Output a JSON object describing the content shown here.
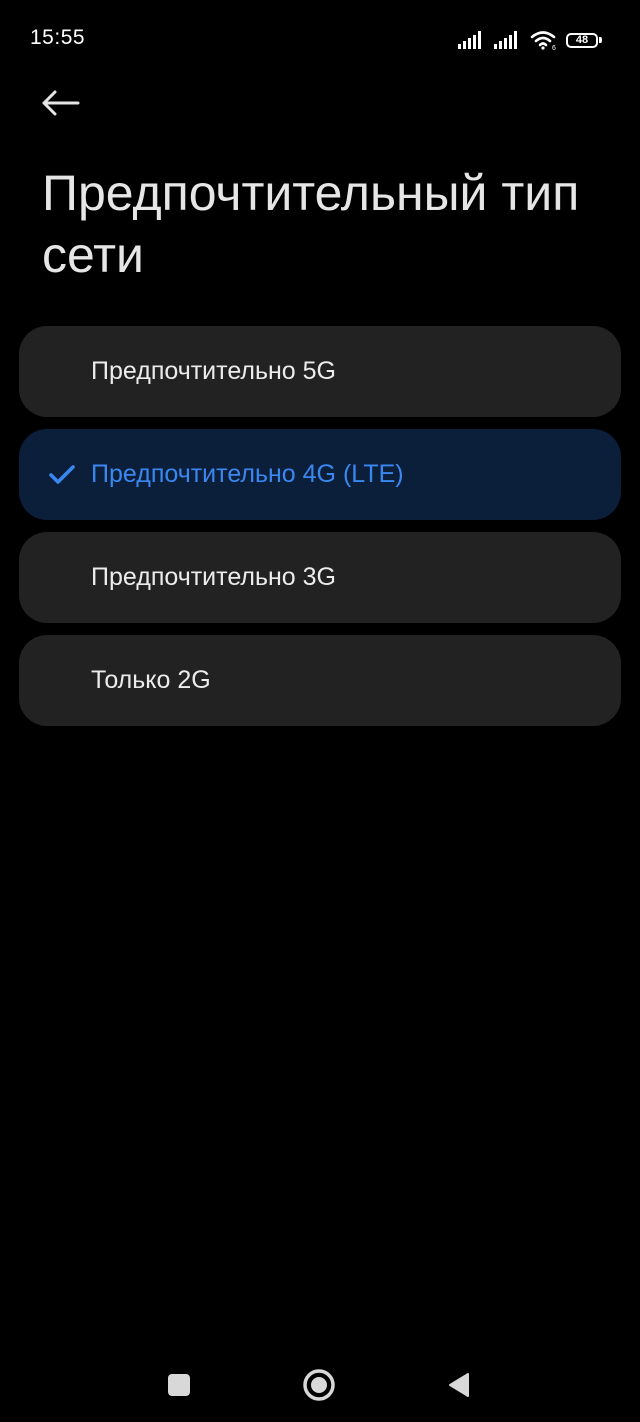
{
  "status_bar": {
    "time": "15:55",
    "battery_level": "48",
    "icons": [
      "signal-icon",
      "signal-icon",
      "wifi-icon",
      "battery-icon"
    ]
  },
  "header": {
    "back_icon": "arrow-left-icon",
    "title": "Предпочтительный тип сети"
  },
  "options": [
    {
      "label": "Предпочтительно 5G",
      "selected": false
    },
    {
      "label": "Предпочтительно 4G (LTE)",
      "selected": true
    },
    {
      "label": "Предпочтительно 3G",
      "selected": false
    },
    {
      "label": "Только 2G",
      "selected": false
    }
  ],
  "nav_bar": {
    "icons": [
      "recents-square-icon",
      "home-circle-icon",
      "back-triangle-icon"
    ]
  },
  "colors": {
    "background": "#000000",
    "option_background": "#222222",
    "selected_background": "#0b1f3b",
    "accent": "#3a87f0"
  }
}
